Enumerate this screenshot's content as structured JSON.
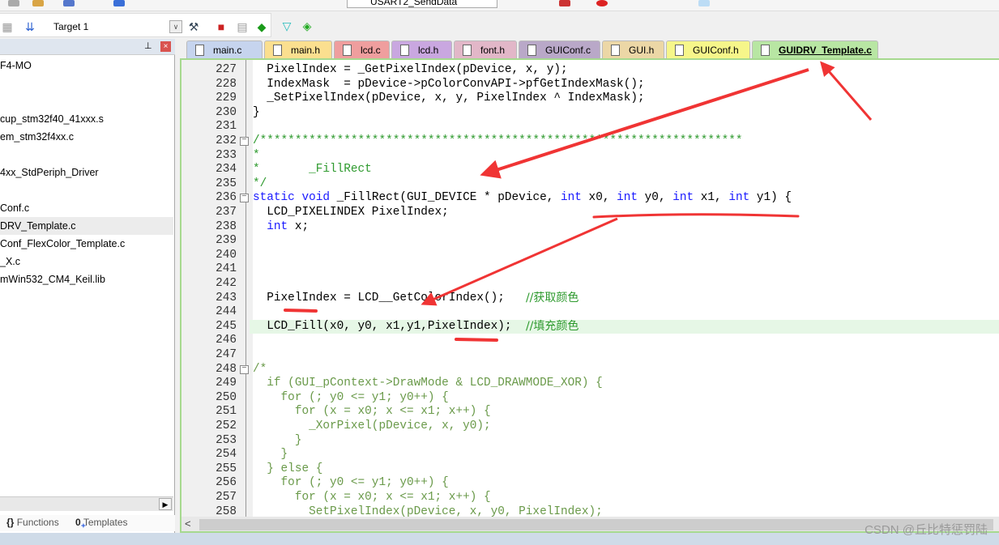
{
  "toolbar": {
    "config_combo": "USART2_SendData",
    "target": "Target 1"
  },
  "project_panel": {
    "items": [
      "F4-MO",
      "",
      "",
      "cup_stm32f40_41xxx.s",
      "em_stm32f4xx.c",
      "",
      "4xx_StdPeriph_Driver",
      "",
      "Conf.c",
      "DRV_Template.c",
      "Conf_FlexColor_Template.c",
      "_X.c",
      "mWin532_CM4_Keil.lib"
    ],
    "selected_index": 9,
    "tabs": [
      "Functions",
      "Templates"
    ]
  },
  "tabs": [
    {
      "label": "main.c",
      "color": "#c6d4ee"
    },
    {
      "label": "main.h",
      "color": "#fbdf8f"
    },
    {
      "label": "lcd.c",
      "color": "#ef9e9e"
    },
    {
      "label": "lcd.h",
      "color": "#c9a7e0"
    },
    {
      "label": "font.h",
      "color": "#e2b7c8"
    },
    {
      "label": "GUIConf.c",
      "color": "#b9a8c8"
    },
    {
      "label": "GUI.h",
      "color": "#ecd7a6"
    },
    {
      "label": "GUIConf.h",
      "color": "#f6f68a"
    },
    {
      "label": "GUIDRV_Template.c",
      "color": "#b8e6a3"
    }
  ],
  "code": [
    {
      "n": "227",
      "t": "  PixelIndex = _GetPixelIndex(pDevice, x, y);"
    },
    {
      "n": "228",
      "t": "  IndexMask  = pDevice->pColorConvAPI->pfGetIndexMask();"
    },
    {
      "n": "229",
      "t": "  _SetPixelIndex(pDevice, x, y, PixelIndex ^ IndexMask);"
    },
    {
      "n": "230",
      "t": "}"
    },
    {
      "n": "231",
      "t": ""
    },
    {
      "n": "232",
      "t": "/*********************************************************************",
      "c": "cm",
      "fold": true
    },
    {
      "n": "233",
      "t": "*",
      "c": "cm"
    },
    {
      "n": "234",
      "t": "*       _FillRect",
      "c": "cm"
    },
    {
      "n": "235",
      "t": "*/",
      "c": "cm"
    },
    {
      "n": "236",
      "t": "static void _FillRect(GUI_DEVICE * pDevice, int x0, int y0, int x1, int y1) {",
      "fold": true,
      "kw": true
    },
    {
      "n": "237",
      "t": "  LCD_PIXELINDEX PixelIndex;"
    },
    {
      "n": "238",
      "t": "  int x;",
      "kw": true
    },
    {
      "n": "239",
      "t": ""
    },
    {
      "n": "240",
      "t": ""
    },
    {
      "n": "241",
      "t": ""
    },
    {
      "n": "242",
      "t": ""
    },
    {
      "n": "243",
      "t": "  PixelIndex = LCD__GetColorIndex();   ",
      "cm_tail": "//获取颜色"
    },
    {
      "n": "244",
      "t": ""
    },
    {
      "n": "245",
      "t": "  LCD_Fill(x0, y0, x1,y1,PixelIndex);  ",
      "cm_tail": "//填充颜色",
      "hl": true
    },
    {
      "n": "246",
      "t": ""
    },
    {
      "n": "247",
      "t": ""
    },
    {
      "n": "248",
      "t": "/*",
      "c": "cmb",
      "fold": true
    },
    {
      "n": "249",
      "t": "  if (GUI_pContext->DrawMode & LCD_DRAWMODE_XOR) {",
      "c": "cmb"
    },
    {
      "n": "250",
      "t": "    for (; y0 <= y1; y0++) {",
      "c": "cmb"
    },
    {
      "n": "251",
      "t": "      for (x = x0; x <= x1; x++) {",
      "c": "cmb"
    },
    {
      "n": "252",
      "t": "        _XorPixel(pDevice, x, y0);",
      "c": "cmb"
    },
    {
      "n": "253",
      "t": "      }",
      "c": "cmb"
    },
    {
      "n": "254",
      "t": "    }",
      "c": "cmb"
    },
    {
      "n": "255",
      "t": "  } else {",
      "c": "cmb"
    },
    {
      "n": "256",
      "t": "    for (; y0 <= y1; y0++) {",
      "c": "cmb"
    },
    {
      "n": "257",
      "t": "      for (x = x0; x <= x1; x++) {",
      "c": "cmb"
    },
    {
      "n": "258",
      "t": "        SetPixelIndex(pDevice, x, y0, PixelIndex);",
      "c": "cmb"
    }
  ],
  "watermark": "CSDN @丘比特惩罚陆",
  "annotation_color": "#f03434"
}
